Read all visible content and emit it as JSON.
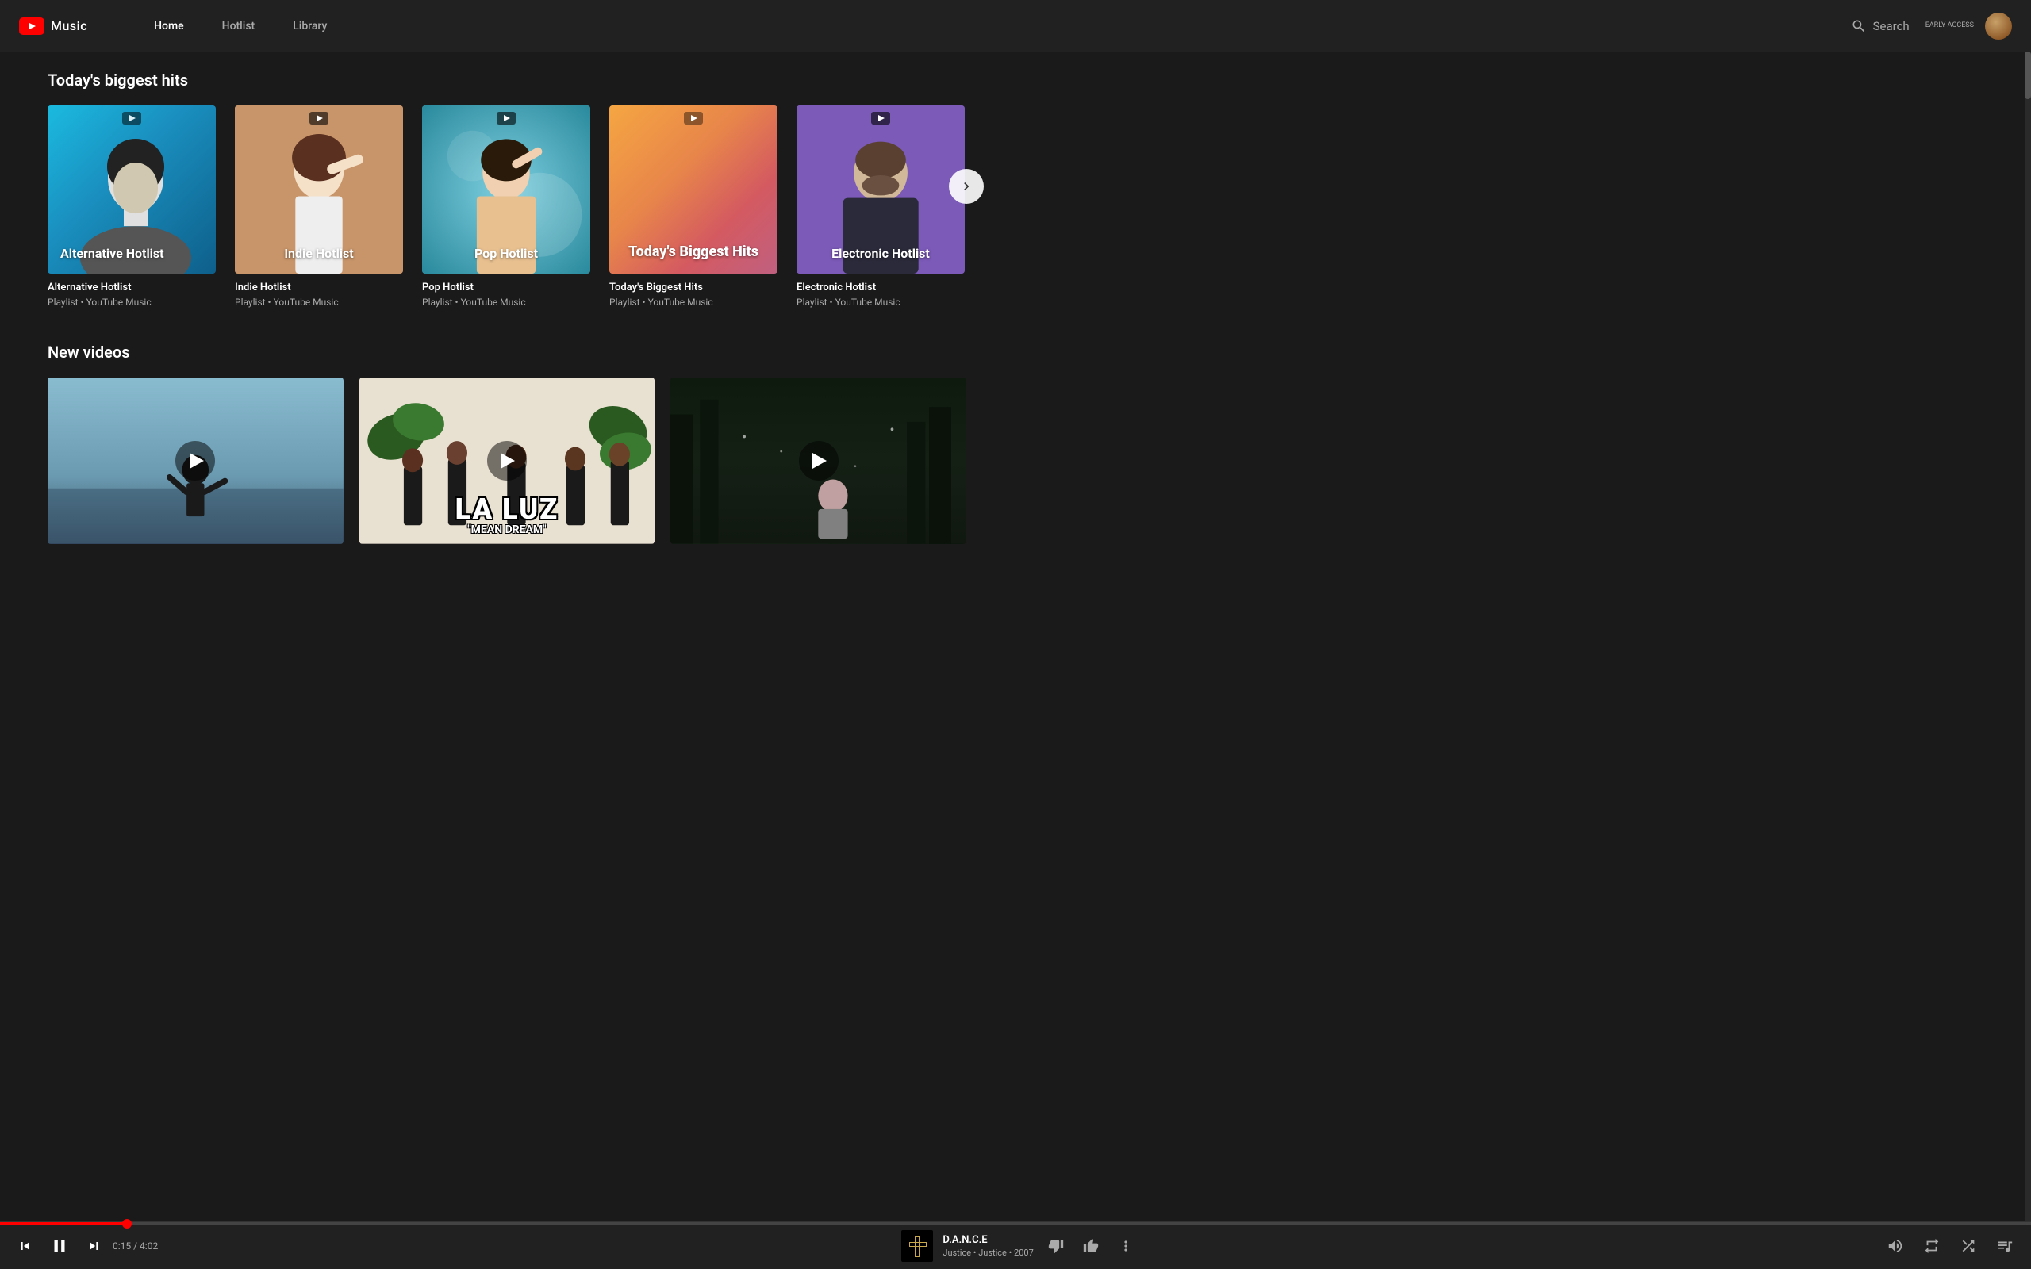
{
  "header": {
    "logo_text": "Music",
    "nav": [
      {
        "label": "Home",
        "active": true
      },
      {
        "label": "Hotlist",
        "active": false
      },
      {
        "label": "Library",
        "active": false
      }
    ],
    "search_label": "Search",
    "early_access": "EARLY ACCESS"
  },
  "sections": {
    "biggest_hits": {
      "title": "Today's biggest hits",
      "cards": [
        {
          "id": "alt-hotlist",
          "label": "Alternative Hotlist",
          "title_overlay": "Alternative Hotlist",
          "meta": "Playlist • YouTube Music",
          "theme": "alt"
        },
        {
          "id": "indie-hotlist",
          "label": "Indie Hotlist",
          "title_overlay": "Indie Hotlist",
          "meta": "Playlist • YouTube Music",
          "theme": "indie"
        },
        {
          "id": "pop-hotlist",
          "label": "Pop Hotlist",
          "title_overlay": "Pop Hotlist",
          "meta": "Playlist • YouTube Music",
          "theme": "pop"
        },
        {
          "id": "biggest-hits",
          "label": "Today's Biggest Hits",
          "title_overlay": "Today's Biggest Hits",
          "meta": "Playlist • YouTube Music",
          "theme": "biggest"
        },
        {
          "id": "electronic-hotlist",
          "label": "Electronic Hotlist",
          "title_overlay": "Electronic Hotlist",
          "meta": "Playlist • YouTube Music",
          "theme": "electronic"
        }
      ]
    },
    "new_videos": {
      "title": "New videos",
      "videos": [
        {
          "id": "video-1",
          "theme": "vthumb-1"
        },
        {
          "id": "video-la-luz",
          "title": "LA LUZ",
          "subtitle": "\"MEAN DREAM\"",
          "theme": "vthumb-2"
        },
        {
          "id": "video-3",
          "theme": "vthumb-3"
        },
        {
          "id": "video-justice",
          "theme": "vthumb-4"
        }
      ]
    }
  },
  "player": {
    "progress_percent": 6.25,
    "time_current": "0:15",
    "time_total": "4:02",
    "track_title": "D.A.N.C.E",
    "track_artist": "Justice",
    "track_album": "Justice",
    "track_year": "2007",
    "track_meta": "Justice • Justice • 2007",
    "thumbs_down_label": "Dislike",
    "thumbs_up_label": "Like",
    "more_label": "More options",
    "volume_label": "Volume",
    "repeat_label": "Repeat",
    "shuffle_label": "Shuffle",
    "queue_label": "Queue"
  }
}
